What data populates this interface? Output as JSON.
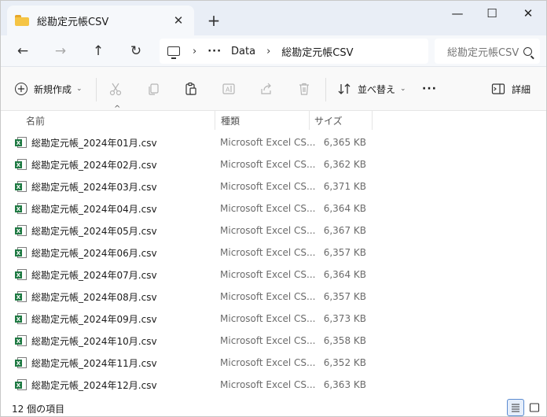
{
  "window": {
    "tab_title": "総勘定元帳CSV",
    "tab_close_glyph": "✕",
    "new_tab_glyph": "+",
    "minimize_glyph": "—",
    "maximize_glyph": "☐",
    "close_glyph": "✕"
  },
  "nav": {
    "back_glyph": "←",
    "forward_glyph": "→",
    "up_glyph": "↑",
    "refresh_glyph": "↻",
    "breadcrumb": {
      "sep": "›",
      "overflow": "···",
      "crumbs": [
        "Data",
        "総勘定元帳CSV"
      ]
    },
    "search_placeholder": "総勘定元帳CSV"
  },
  "toolbar": {
    "new_label": "新規作成",
    "new_caret": "⌄",
    "sort_label": "並べ替え",
    "sort_caret": "⌄",
    "more_glyph": "···",
    "details_label": "詳細"
  },
  "columns": {
    "name": "名前",
    "type": "種類",
    "size": "サイズ",
    "sort_indicator": "^"
  },
  "files": [
    {
      "name": "総勘定元帳_2024年01月.csv",
      "type": "Microsoft Excel CS...",
      "size": "6,365 KB"
    },
    {
      "name": "総勘定元帳_2024年02月.csv",
      "type": "Microsoft Excel CS...",
      "size": "6,362 KB"
    },
    {
      "name": "総勘定元帳_2024年03月.csv",
      "type": "Microsoft Excel CS...",
      "size": "6,371 KB"
    },
    {
      "name": "総勘定元帳_2024年04月.csv",
      "type": "Microsoft Excel CS...",
      "size": "6,364 KB"
    },
    {
      "name": "総勘定元帳_2024年05月.csv",
      "type": "Microsoft Excel CS...",
      "size": "6,367 KB"
    },
    {
      "name": "総勘定元帳_2024年06月.csv",
      "type": "Microsoft Excel CS...",
      "size": "6,357 KB"
    },
    {
      "name": "総勘定元帳_2024年07月.csv",
      "type": "Microsoft Excel CS...",
      "size": "6,364 KB"
    },
    {
      "name": "総勘定元帳_2024年08月.csv",
      "type": "Microsoft Excel CS...",
      "size": "6,357 KB"
    },
    {
      "name": "総勘定元帳_2024年09月.csv",
      "type": "Microsoft Excel CS...",
      "size": "6,373 KB"
    },
    {
      "name": "総勘定元帳_2024年10月.csv",
      "type": "Microsoft Excel CS...",
      "size": "6,358 KB"
    },
    {
      "name": "総勘定元帳_2024年11月.csv",
      "type": "Microsoft Excel CS...",
      "size": "6,352 KB"
    },
    {
      "name": "総勘定元帳_2024年12月.csv",
      "type": "Microsoft Excel CS...",
      "size": "6,363 KB"
    }
  ],
  "file_icon_letter": "X",
  "status": {
    "count_text": "12 個の項目"
  },
  "colors": {
    "accent": "#5b8bd0",
    "excel_green": "#1f7a43",
    "folder_yellow": "#f5c444"
  },
  "icons": {
    "tab": "folder-icon",
    "file": "excel-csv-file-icon",
    "address": "this-pc-icon",
    "search": "search-icon"
  }
}
